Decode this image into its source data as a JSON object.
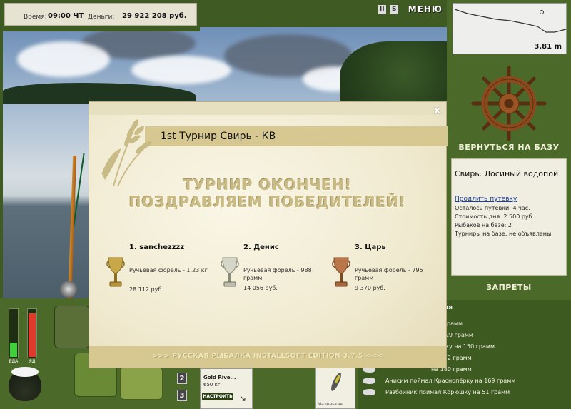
{
  "topbar": {
    "time_label": "Время:",
    "time_value": "09:00 ЧТ",
    "money_label": "Деньги:",
    "money_value": "29 922 208 руб.",
    "icon_pause": "II",
    "icon_sound": "S",
    "menu_label": "МЕНЮ"
  },
  "depth": {
    "value": "3,81 m"
  },
  "right": {
    "base_button": "ВЕРНУТЬСЯ НА БАЗУ",
    "location": "Свирь. Лосиный водопой",
    "extend_link": "Продлить путевку",
    "lines": [
      "Осталось путевки: 4 час.",
      "Стоимость дня: 2 500 руб.",
      "Рыбаков на базе: 2",
      "Турниры на базе: не объявлены"
    ],
    "bans_button": "ЗАПРЕТЫ"
  },
  "news": {
    "header": "ия",
    "rows": [
      "426 грамм",
      "у на 29 грамм",
      "опёрку на 150 грамм",
      "на 172 грамм",
      "на 180 грамм",
      "Анисим поймал Краснопёрку на 169 грамм",
      "Разбойник поймал Корюшку на 51 грамм"
    ]
  },
  "bottom": {
    "food_label": "ЕДА",
    "stamina_label": "ЯД",
    "slot2": "2",
    "slot3": "3",
    "tackle_name": "Gold Rive...",
    "tackle_weight": "650 кг",
    "setup_label": "НАСТРОИТЬ",
    "lure_label": "Маленькая"
  },
  "modal": {
    "title": "1st Турнир Свирь - КВ",
    "close": "x",
    "headline1": "ТУРНИР ОКОНЧЕН!",
    "headline2": "ПОЗДРАВЛЯЕМ ПОБЕДИТЕЛЕЙ!",
    "winners": [
      {
        "name": "1. sanchezzzz",
        "fish": "Ручьевая форель - 1,23 кг",
        "prize": "28 112 руб."
      },
      {
        "name": "2. Денис",
        "fish": "Ручьевая форель - 988 грамм",
        "prize": "14 056 руб."
      },
      {
        "name": "3. Царь",
        "fish": "Ручьевая форель - 795 грамм",
        "prize": "9 370 руб."
      }
    ],
    "footer": ">>> РУССКАЯ РЫБАЛКА INSTALLSOFT EDITION 3.7.5 <<<"
  },
  "colors": {
    "gold": "#c9a84a",
    "silver": "#c8c8c0",
    "bronze": "#b9774a"
  }
}
